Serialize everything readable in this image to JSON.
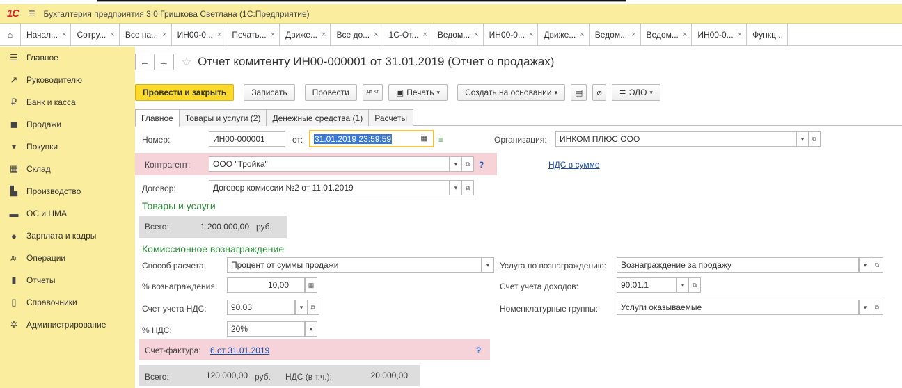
{
  "app": {
    "logo": "1С",
    "title": "Бухгалтерия предприятия 3.0 Гришкова Светлана  (1С:Предприятие)"
  },
  "window_tabs": [
    {
      "label": "Начал..."
    },
    {
      "label": "Сотру..."
    },
    {
      "label": "Все на..."
    },
    {
      "label": "ИН00-0..."
    },
    {
      "label": "Печать..."
    },
    {
      "label": "Движе..."
    },
    {
      "label": "Все до..."
    },
    {
      "label": "1С-От..."
    },
    {
      "label": "Ведом..."
    },
    {
      "label": "ИН00-0..."
    },
    {
      "label": "Движе..."
    },
    {
      "label": "Ведом..."
    },
    {
      "label": "Ведом..."
    },
    {
      "label": "ИН00-0..."
    },
    {
      "label": "Функц..."
    }
  ],
  "sidebar": {
    "items": [
      {
        "label": "Главное",
        "icon": "menu-icon"
      },
      {
        "label": "Руководителю",
        "icon": "trend-icon"
      },
      {
        "label": "Банк и касса",
        "icon": "ruble-icon"
      },
      {
        "label": "Продажи",
        "icon": "bag-icon"
      },
      {
        "label": "Покупки",
        "icon": "cart-icon"
      },
      {
        "label": "Склад",
        "icon": "warehouse-icon"
      },
      {
        "label": "Производство",
        "icon": "factory-icon"
      },
      {
        "label": "ОС и НМА",
        "icon": "truck-icon"
      },
      {
        "label": "Зарплата и кадры",
        "icon": "person-icon"
      },
      {
        "label": "Операции",
        "icon": "dt-kt-icon"
      },
      {
        "label": "Отчеты",
        "icon": "bar-chart-icon"
      },
      {
        "label": "Справочники",
        "icon": "book-icon"
      },
      {
        "label": "Администрирование",
        "icon": "gear-icon"
      }
    ]
  },
  "document": {
    "title": "Отчет комитенту ИН00-000001 от 31.01.2019 (Отчет о продажах)"
  },
  "toolbar": {
    "post_close": "Провести и закрыть",
    "save": "Записать",
    "post": "Провести",
    "dtkt": "Дт Кт",
    "print": "Печать",
    "create_based": "Создать на основании",
    "edo": "ЭДО"
  },
  "form_tabs": [
    {
      "label": "Главное"
    },
    {
      "label": "Товары и услуги (2)"
    },
    {
      "label": "Денежные средства (1)"
    },
    {
      "label": "Расчеты"
    }
  ],
  "form": {
    "number_label": "Номер:",
    "number_value": "ИН00-000001",
    "date_label": "от:",
    "date_value": "31.01.2019 23:59:59",
    "org_label": "Организация:",
    "org_value": "ИНКОМ ПЛЮС ООО",
    "counterparty_label": "Контрагент:",
    "counterparty_value": "ООО \"Тройка\"",
    "vat_link": "НДС в сумме",
    "contract_label": "Договор:",
    "contract_value": "Договор комиссии №2 от 11.01.2019",
    "goods_section": "Товары и услуги",
    "total_label": "Всего:",
    "total_value": "1 200 000,00",
    "currency": "руб.",
    "commission_section": "Комиссионное вознаграждение",
    "calc_method_label": "Способ расчета:",
    "calc_method_value": "Процент от суммы продажи",
    "service_label": "Услуга по вознаграждению:",
    "service_value": "Вознаграждение за продажу",
    "reward_pct_label": "% вознаграждения:",
    "reward_pct_value": "10,00",
    "income_acc_label": "Счет учета доходов:",
    "income_acc_value": "90.01.1",
    "vat_acc_label": "Счет учета НДС:",
    "vat_acc_value": "90.03",
    "nomen_label": "Номенклатурные группы:",
    "nomen_value": "Услуги оказываемые",
    "vat_pct_label": "% НДС:",
    "vat_pct_value": "20%",
    "invoice_label": "Счет-фактура:",
    "invoice_link": "6 от 31.01.2019",
    "commission_total_label": "Всего:",
    "commission_total_value": "120 000,00",
    "commission_currency": "руб.",
    "vat_incl_label": "НДС (в т.ч.):",
    "vat_incl_value": "20 000,00"
  }
}
